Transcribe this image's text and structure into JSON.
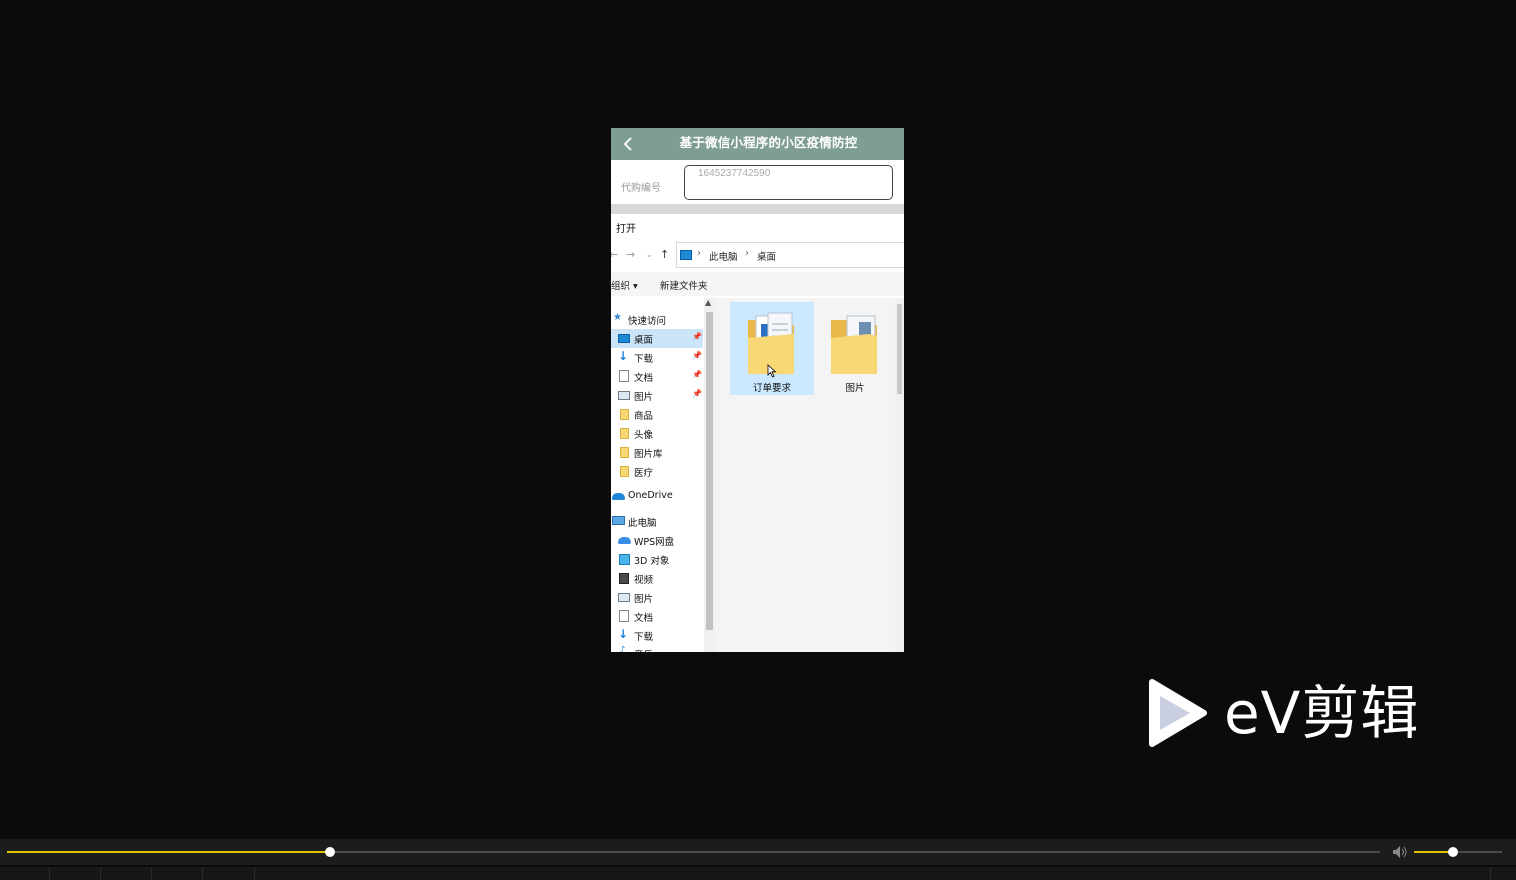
{
  "miniprogram": {
    "title": "基于微信小程序的小区疫情防控",
    "form_label": "代购编号",
    "form_value": "1645237742590"
  },
  "dialog": {
    "title": "打开",
    "breadcrumb": [
      "此电脑",
      "桌面"
    ],
    "toolbar": {
      "organize": "组织 ▾",
      "new_folder": "新建文件夹"
    },
    "nav": [
      {
        "label": "快速访问",
        "icon": "star-icon"
      },
      {
        "label": "桌面",
        "icon": "desktop-icon",
        "pinned": true,
        "selected": true
      },
      {
        "label": "下载",
        "icon": "download-arrow-icon",
        "pinned": true
      },
      {
        "label": "文档",
        "icon": "document-icon",
        "pinned": true
      },
      {
        "label": "图片",
        "icon": "picture-icon",
        "pinned": true
      },
      {
        "label": "商品",
        "icon": "folder-icon"
      },
      {
        "label": "头像",
        "icon": "folder-icon"
      },
      {
        "label": "图片库",
        "icon": "folder-icon"
      },
      {
        "label": "医疗",
        "icon": "folder-icon"
      },
      {
        "label": "OneDrive",
        "icon": "cloud-icon"
      },
      {
        "label": "此电脑",
        "icon": "computer-icon"
      },
      {
        "label": "WPS网盘",
        "icon": "cloud-drive-icon"
      },
      {
        "label": "3D 对象",
        "icon": "cube-icon"
      },
      {
        "label": "视频",
        "icon": "video-icon"
      },
      {
        "label": "图片",
        "icon": "picture-icon"
      },
      {
        "label": "文档",
        "icon": "document-icon"
      },
      {
        "label": "下载",
        "icon": "download-arrow-icon"
      },
      {
        "label": "音乐",
        "icon": "music-icon"
      }
    ],
    "files": [
      {
        "label": "订单要求",
        "selected": true
      },
      {
        "label": "图片",
        "selected": false
      }
    ]
  },
  "watermark": {
    "text": "eV剪辑"
  },
  "player": {
    "progress": 0.235,
    "volume": 0.44,
    "accent": "#e0c200"
  }
}
